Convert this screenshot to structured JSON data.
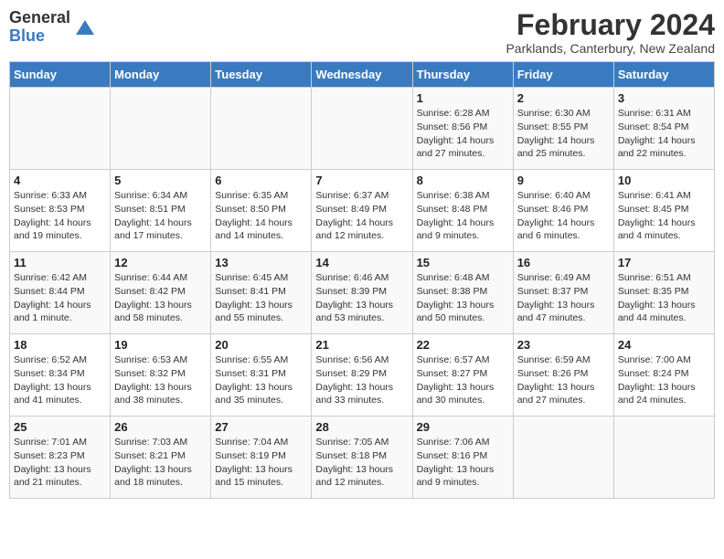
{
  "header": {
    "logo_general": "General",
    "logo_blue": "Blue",
    "month_title": "February 2024",
    "location": "Parklands, Canterbury, New Zealand"
  },
  "days_of_week": [
    "Sunday",
    "Monday",
    "Tuesday",
    "Wednesday",
    "Thursday",
    "Friday",
    "Saturday"
  ],
  "weeks": [
    [
      {
        "day": "",
        "info": ""
      },
      {
        "day": "",
        "info": ""
      },
      {
        "day": "",
        "info": ""
      },
      {
        "day": "",
        "info": ""
      },
      {
        "day": "1",
        "info": "Sunrise: 6:28 AM\nSunset: 8:56 PM\nDaylight: 14 hours and 27 minutes."
      },
      {
        "day": "2",
        "info": "Sunrise: 6:30 AM\nSunset: 8:55 PM\nDaylight: 14 hours and 25 minutes."
      },
      {
        "day": "3",
        "info": "Sunrise: 6:31 AM\nSunset: 8:54 PM\nDaylight: 14 hours and 22 minutes."
      }
    ],
    [
      {
        "day": "4",
        "info": "Sunrise: 6:33 AM\nSunset: 8:53 PM\nDaylight: 14 hours and 19 minutes."
      },
      {
        "day": "5",
        "info": "Sunrise: 6:34 AM\nSunset: 8:51 PM\nDaylight: 14 hours and 17 minutes."
      },
      {
        "day": "6",
        "info": "Sunrise: 6:35 AM\nSunset: 8:50 PM\nDaylight: 14 hours and 14 minutes."
      },
      {
        "day": "7",
        "info": "Sunrise: 6:37 AM\nSunset: 8:49 PM\nDaylight: 14 hours and 12 minutes."
      },
      {
        "day": "8",
        "info": "Sunrise: 6:38 AM\nSunset: 8:48 PM\nDaylight: 14 hours and 9 minutes."
      },
      {
        "day": "9",
        "info": "Sunrise: 6:40 AM\nSunset: 8:46 PM\nDaylight: 14 hours and 6 minutes."
      },
      {
        "day": "10",
        "info": "Sunrise: 6:41 AM\nSunset: 8:45 PM\nDaylight: 14 hours and 4 minutes."
      }
    ],
    [
      {
        "day": "11",
        "info": "Sunrise: 6:42 AM\nSunset: 8:44 PM\nDaylight: 14 hours and 1 minute."
      },
      {
        "day": "12",
        "info": "Sunrise: 6:44 AM\nSunset: 8:42 PM\nDaylight: 13 hours and 58 minutes."
      },
      {
        "day": "13",
        "info": "Sunrise: 6:45 AM\nSunset: 8:41 PM\nDaylight: 13 hours and 55 minutes."
      },
      {
        "day": "14",
        "info": "Sunrise: 6:46 AM\nSunset: 8:39 PM\nDaylight: 13 hours and 53 minutes."
      },
      {
        "day": "15",
        "info": "Sunrise: 6:48 AM\nSunset: 8:38 PM\nDaylight: 13 hours and 50 minutes."
      },
      {
        "day": "16",
        "info": "Sunrise: 6:49 AM\nSunset: 8:37 PM\nDaylight: 13 hours and 47 minutes."
      },
      {
        "day": "17",
        "info": "Sunrise: 6:51 AM\nSunset: 8:35 PM\nDaylight: 13 hours and 44 minutes."
      }
    ],
    [
      {
        "day": "18",
        "info": "Sunrise: 6:52 AM\nSunset: 8:34 PM\nDaylight: 13 hours and 41 minutes."
      },
      {
        "day": "19",
        "info": "Sunrise: 6:53 AM\nSunset: 8:32 PM\nDaylight: 13 hours and 38 minutes."
      },
      {
        "day": "20",
        "info": "Sunrise: 6:55 AM\nSunset: 8:31 PM\nDaylight: 13 hours and 35 minutes."
      },
      {
        "day": "21",
        "info": "Sunrise: 6:56 AM\nSunset: 8:29 PM\nDaylight: 13 hours and 33 minutes."
      },
      {
        "day": "22",
        "info": "Sunrise: 6:57 AM\nSunset: 8:27 PM\nDaylight: 13 hours and 30 minutes."
      },
      {
        "day": "23",
        "info": "Sunrise: 6:59 AM\nSunset: 8:26 PM\nDaylight: 13 hours and 27 minutes."
      },
      {
        "day": "24",
        "info": "Sunrise: 7:00 AM\nSunset: 8:24 PM\nDaylight: 13 hours and 24 minutes."
      }
    ],
    [
      {
        "day": "25",
        "info": "Sunrise: 7:01 AM\nSunset: 8:23 PM\nDaylight: 13 hours and 21 minutes."
      },
      {
        "day": "26",
        "info": "Sunrise: 7:03 AM\nSunset: 8:21 PM\nDaylight: 13 hours and 18 minutes."
      },
      {
        "day": "27",
        "info": "Sunrise: 7:04 AM\nSunset: 8:19 PM\nDaylight: 13 hours and 15 minutes."
      },
      {
        "day": "28",
        "info": "Sunrise: 7:05 AM\nSunset: 8:18 PM\nDaylight: 13 hours and 12 minutes."
      },
      {
        "day": "29",
        "info": "Sunrise: 7:06 AM\nSunset: 8:16 PM\nDaylight: 13 hours and 9 minutes."
      },
      {
        "day": "",
        "info": ""
      },
      {
        "day": "",
        "info": ""
      }
    ]
  ]
}
